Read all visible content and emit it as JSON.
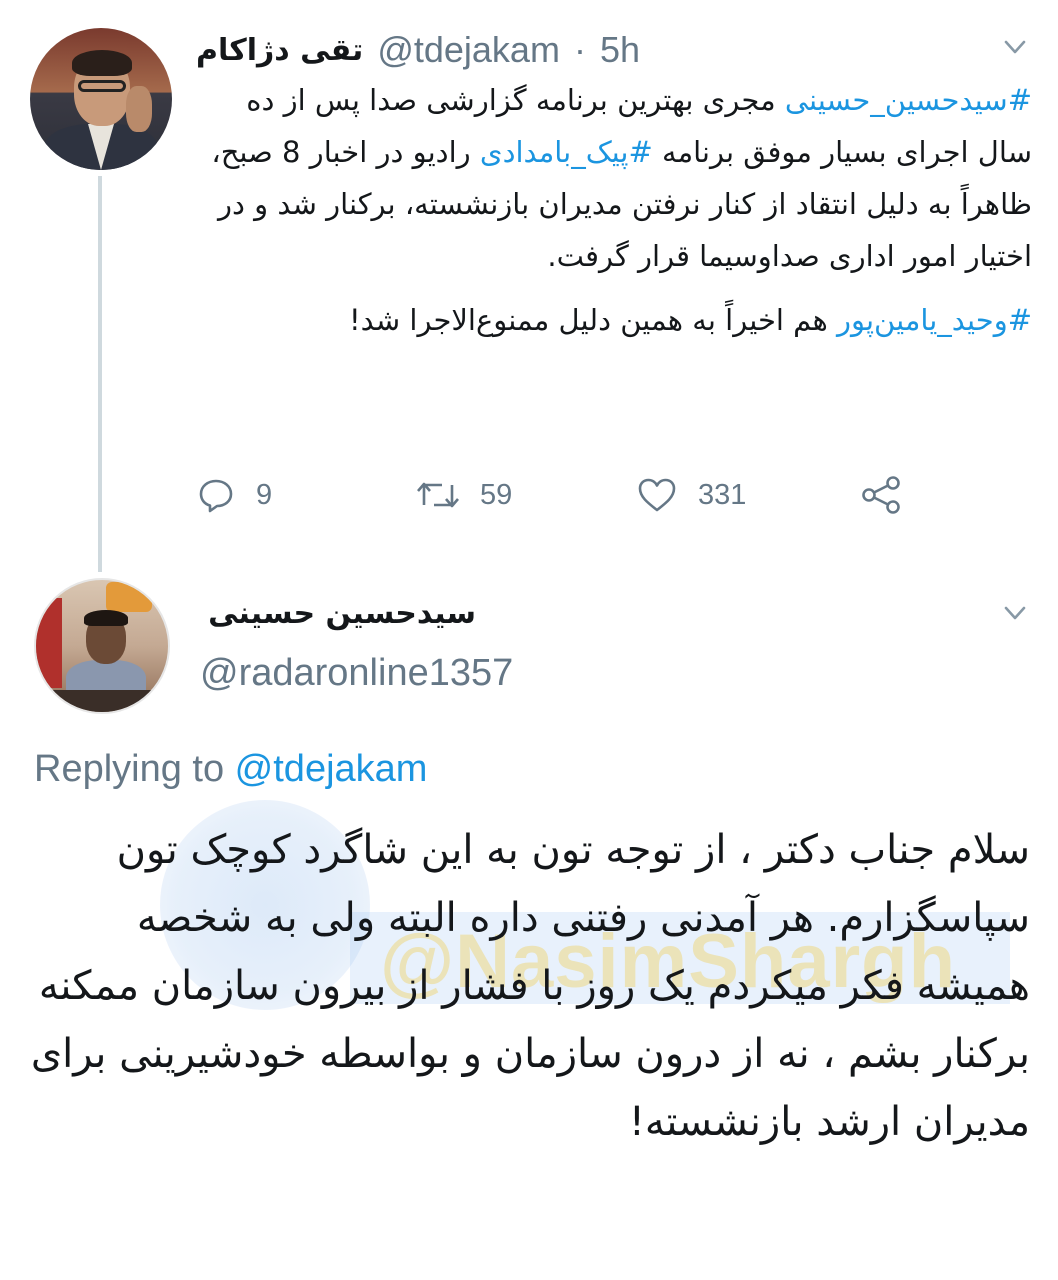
{
  "tweet1": {
    "display_name": "تقی دژاکام",
    "handle": "@tdejakam",
    "separator": "·",
    "time": "5h",
    "para1_tag1": "#سیدحسین_حسینی",
    "para1_text1": " مجری بهترین برنامه گزارشی صدا پس از ده سال اجرای بسیار موفق برنامه ",
    "para1_tag2": "#پیک_بامدادی",
    "para1_text2": " رادیو در اخبار 8 صبح، ظاهراً به دلیل انتقاد از کنار نرفتن مدیران بازنشسته، برکنار شد و در اختیار امور اداری صداوسیما قرار گرفت.",
    "para2_tag": "#وحید_یامین‌پور",
    "para2_text": " هم اخیراً به همین دلیل ممنوع‌الاجرا شد!",
    "reply_count": "9",
    "retweet_count": "59",
    "like_count": "331"
  },
  "tweet2": {
    "display_name": "سیدحسین حسینی",
    "handle": "@radaronline1357",
    "replying_prefix": "Replying to ",
    "replying_to": "@tdejakam",
    "body": "سلام جناب دکتر ، از توجه تون به این شاگرد کوچک تون سپاسگزارم. هر آمدنی رفتنی داره البته ولی به شخصه همیشه فکر میکردم یک روز با فشار از بیرون سازمان ممکنه برکنار بشم ، نه از درون سازمان و بواسطه خودشیرینی برای مدیران ارشد بازنشسته!"
  },
  "watermark": {
    "text": "@NasimShargh"
  },
  "icons": {
    "reply": "reply-icon",
    "retweet": "retweet-icon",
    "like": "like-icon",
    "share": "share-icon",
    "more": "chevron-down-icon"
  },
  "colors": {
    "text": "#14171a",
    "secondary": "#657786",
    "link": "#1b95e0",
    "thread_line": "#cfd9de"
  }
}
